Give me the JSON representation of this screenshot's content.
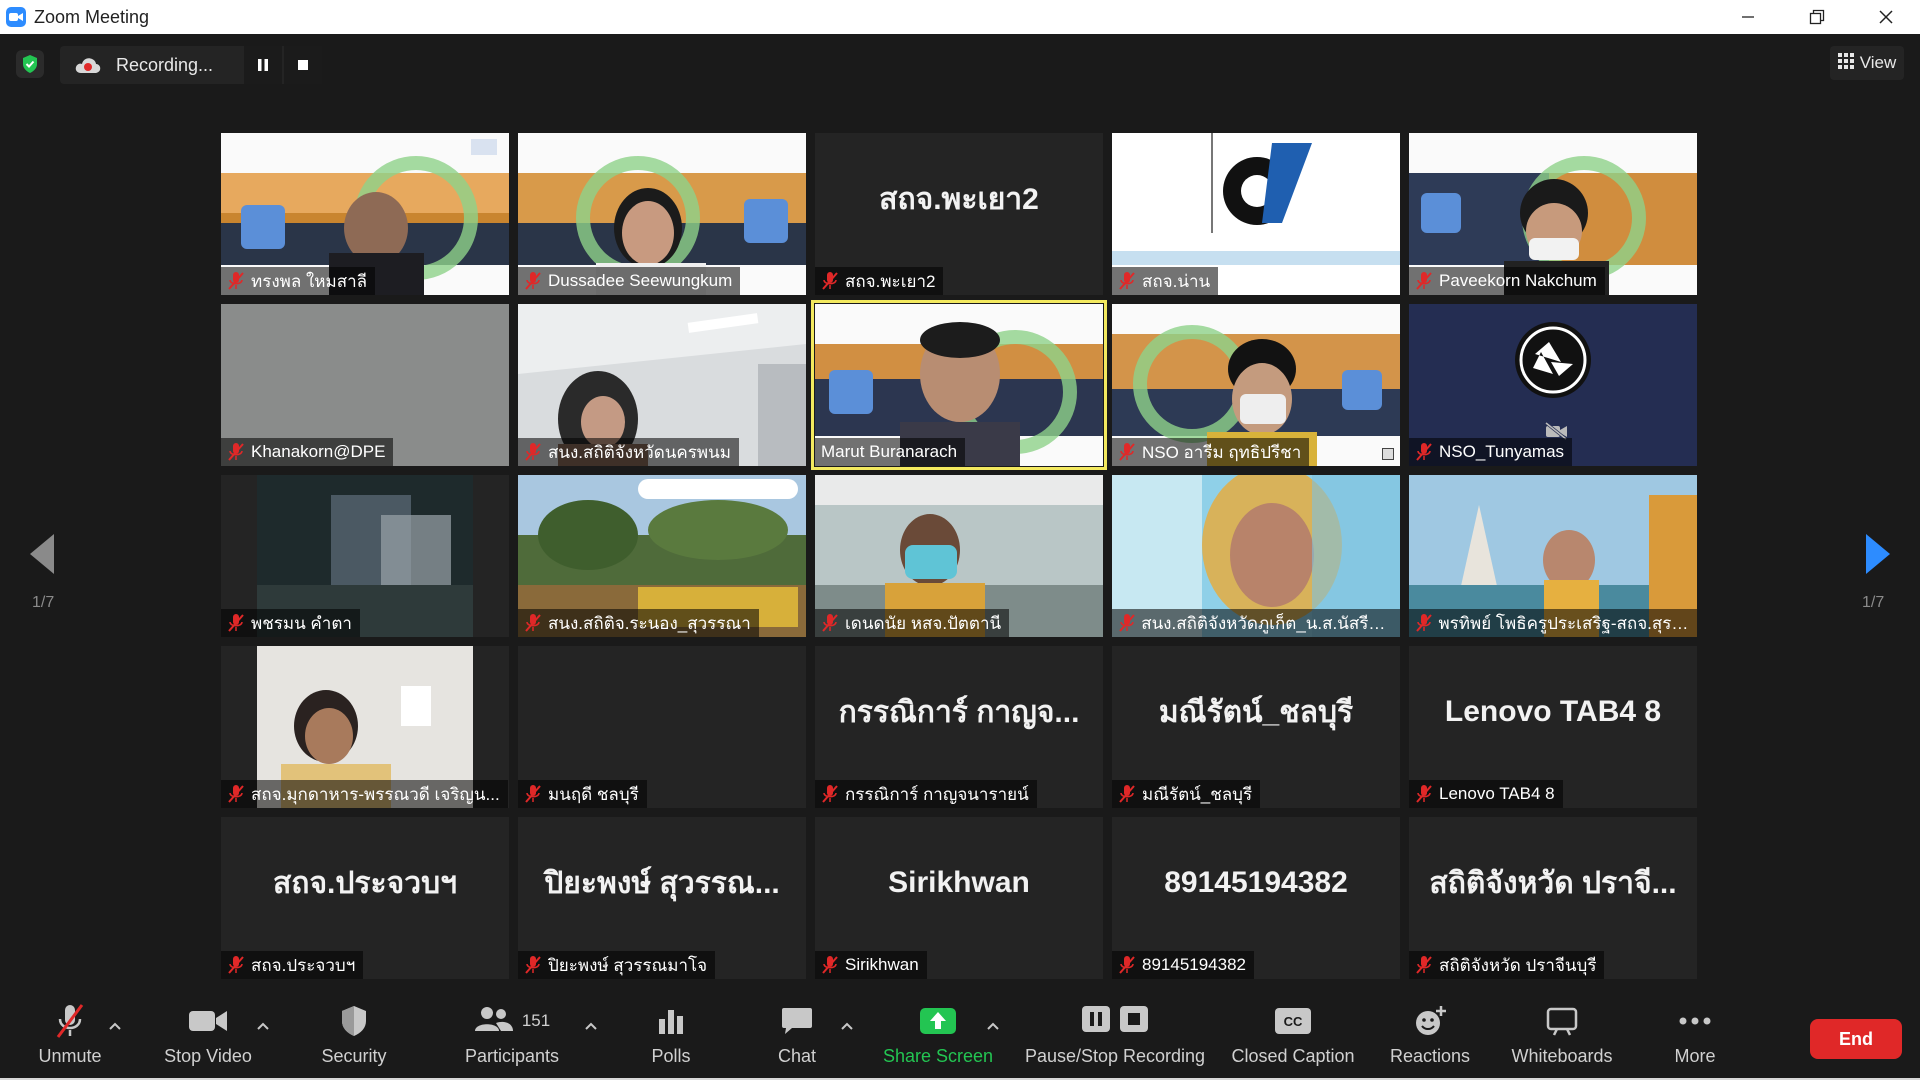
{
  "window": {
    "title": "Zoom Meeting"
  },
  "topbar": {
    "recording_label": "Recording...",
    "view_label": "View"
  },
  "pages": {
    "left": "1/7",
    "right": "1/7"
  },
  "tiles": [
    {
      "name": "ทรงพล ใหมสาลี",
      "center": ""
    },
    {
      "name": "Dussadee Seewungkum",
      "center": ""
    },
    {
      "name": "สถจ.พะเยา2",
      "center": "สถจ.พะเยา2"
    },
    {
      "name": "สถจ.น่าน",
      "center": ""
    },
    {
      "name": "Paveekorn Nakchum",
      "center": ""
    },
    {
      "name": "Khanakorn@DPE",
      "center": ""
    },
    {
      "name": "สนง.สถิติจังหวัดนครพนม",
      "center": ""
    },
    {
      "name": "Marut Buranarach",
      "center": ""
    },
    {
      "name": "NSO อารีม ฤทธิปรีชา",
      "center": ""
    },
    {
      "name": "NSO_Tunyamas",
      "center": ""
    },
    {
      "name": "พชรมน คำตา",
      "center": ""
    },
    {
      "name": "สนง.สถิติจ.ระนอง_สุวรรณา",
      "center": ""
    },
    {
      "name": "เดนดนัย หสจ.ปัตตานี",
      "center": ""
    },
    {
      "name": "สนง.สถิติจังหวัดภูเก็ต_น.ส.นัสรียะ...",
      "center": ""
    },
    {
      "name": "พรทิพย์ โพธิครูประเสริฐ-สถจ.สุรา...",
      "center": ""
    },
    {
      "name": "สถจ.มุกดาหาร-พรรณวดี เจริญน...",
      "center": ""
    },
    {
      "name": "มนฤดี ชลบุรี",
      "center": ""
    },
    {
      "name": "กรรณิการ์ กาญจนารายน์",
      "center": "กรรณิการ์ กาญจ..."
    },
    {
      "name": "มณีรัตน์_ชลบุรี",
      "center": "มณีรัตน์_ชลบุรี"
    },
    {
      "name": "Lenovo TAB4 8",
      "center": "Lenovo TAB4 8"
    },
    {
      "name": "สถจ.ประจวบฯ",
      "center": "สถจ.ประจวบฯ"
    },
    {
      "name": "ปิยะพงษ์ สุวรรณมาโจ",
      "center": "ปิยะพงษ์ สุวรรณ..."
    },
    {
      "name": "Sirikhwan",
      "center": "Sirikhwan"
    },
    {
      "name": "89145194382",
      "center": "89145194382"
    },
    {
      "name": "สถิติจังหวัด ปราจีนบุรี",
      "center": "สถิติจังหวัด ปราจี..."
    }
  ],
  "toolbar": {
    "unmute": "Unmute",
    "stop_video": "Stop Video",
    "security": "Security",
    "participants": "Participants",
    "participants_count": "151",
    "polls": "Polls",
    "chat": "Chat",
    "share_screen": "Share Screen",
    "pause_stop_recording": "Pause/Stop Recording",
    "closed_caption": "Closed Caption",
    "closed_caption_badge": "CC",
    "reactions": "Reactions",
    "whiteboards": "Whiteboards",
    "more": "More",
    "end": "End"
  },
  "colors": {
    "accent_blue": "#2d8cff",
    "end_red": "#e02828",
    "share_green": "#23c552",
    "active_speaker": "#f3e95f",
    "mic_muted": "#e02828"
  }
}
